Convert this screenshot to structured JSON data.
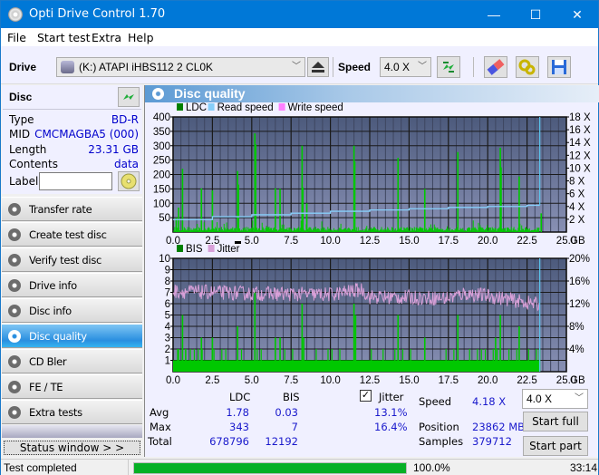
{
  "window": {
    "title": "Opti Drive Control 1.70",
    "minimize": "—",
    "maximize": "☐",
    "close": "✕"
  },
  "menu": [
    "File",
    "Start test",
    "Extra",
    "Help"
  ],
  "toolbar": {
    "drive_label": "Drive",
    "drive_value": "(K:)  ATAPI iHBS112  2 CL0K",
    "speed_label": "Speed",
    "speed_value": "4.0 X"
  },
  "disc": {
    "header": "Disc",
    "rows": [
      {
        "label": "Type",
        "value": "BD-R"
      },
      {
        "label": "MID",
        "value": "CMCMAGBA5 (000)"
      },
      {
        "label": "Length",
        "value": "23.31 GB"
      },
      {
        "label": "Contents",
        "value": "data"
      }
    ],
    "label_field_label": "Label",
    "label_field_value": ""
  },
  "nav": [
    {
      "label": "Transfer rate",
      "active": false
    },
    {
      "label": "Create test disc",
      "active": false
    },
    {
      "label": "Verify test disc",
      "active": false
    },
    {
      "label": "Drive info",
      "active": false
    },
    {
      "label": "Disc info",
      "active": false
    },
    {
      "label": "Disc quality",
      "active": true
    },
    {
      "label": "CD Bler",
      "active": false
    },
    {
      "label": "FE / TE",
      "active": false
    },
    {
      "label": "Extra tests",
      "active": false
    }
  ],
  "status_window_button": "Status window > >",
  "panel_title": "Disc quality",
  "chart_data": [
    {
      "type": "bar",
      "title": "LDC / Read speed",
      "legend": [
        "LDC",
        "Read speed",
        "Write speed"
      ],
      "legend_colors": [
        "#008000",
        "#87cefa",
        "#ff80ff"
      ],
      "legend_placement": "top-left",
      "xlabel": "GB",
      "x_ticks": [
        "0.0",
        "2.5",
        "5.0",
        "7.5",
        "10.0",
        "12.5",
        "15.0",
        "17.5",
        "20.0",
        "22.5",
        "25.0"
      ],
      "xlim": [
        0,
        25
      ],
      "ylim": [
        0,
        400
      ],
      "y_ticks": [
        "50",
        "100",
        "150",
        "200",
        "250",
        "300",
        "350",
        "400"
      ],
      "y2lim": [
        0,
        18
      ],
      "y2_ticks": [
        "2 X",
        "4 X",
        "6 X",
        "8 X",
        "10 X",
        "12 X",
        "14 X",
        "16 X",
        "18 X"
      ],
      "grid": true,
      "ldc_spikes": [
        [
          0.2,
          50
        ],
        [
          0.35,
          85
        ],
        [
          0.6,
          220
        ],
        [
          1.8,
          152
        ],
        [
          2.5,
          145
        ],
        [
          4.1,
          212
        ],
        [
          4.15,
          165
        ],
        [
          5.2,
          343
        ],
        [
          5.25,
          305
        ],
        [
          6.5,
          152
        ],
        [
          6.8,
          150
        ],
        [
          8.2,
          300
        ],
        [
          8.25,
          155
        ],
        [
          8.5,
          100
        ],
        [
          11.5,
          300
        ],
        [
          11.55,
          245
        ],
        [
          14.3,
          258
        ],
        [
          16.0,
          150
        ],
        [
          18.1,
          278
        ],
        [
          20.8,
          293
        ],
        [
          20.85,
          225
        ],
        [
          22.0,
          193
        ],
        [
          23.4,
          65
        ]
      ],
      "read_speed": [
        [
          0,
          1.95
        ],
        [
          2.5,
          2.4
        ],
        [
          5,
          2.7
        ],
        [
          7.5,
          2.95
        ],
        [
          10,
          3.25
        ],
        [
          12.5,
          3.45
        ],
        [
          15,
          3.65
        ],
        [
          17.5,
          3.85
        ],
        [
          20,
          4.0
        ],
        [
          22.5,
          4.18
        ],
        [
          23.31,
          4.18
        ]
      ],
      "end_marker_gb": 23.31
    },
    {
      "type": "bar",
      "title": "BIS / Jitter",
      "legend": [
        "BIS",
        "Jitter"
      ],
      "legend_colors": [
        "#008000",
        "#d8a0d8"
      ],
      "legend_placement": "top-left",
      "xlabel": "GB",
      "x_ticks": [
        "0.0",
        "2.5",
        "5.0",
        "7.5",
        "10.0",
        "12.5",
        "15.0",
        "17.5",
        "20.0",
        "22.5",
        "25.0"
      ],
      "xlim": [
        0,
        25
      ],
      "ylim": [
        0,
        10
      ],
      "y_ticks": [
        "1",
        "2",
        "3",
        "4",
        "5",
        "6",
        "7",
        "8",
        "9",
        "10"
      ],
      "y2lim": [
        0,
        20
      ],
      "y2_ticks": [
        "4%",
        "8%",
        "12%",
        "16%",
        "20%"
      ],
      "grid": true,
      "bis_spikes": [
        [
          0.3,
          2
        ],
        [
          0.6,
          5
        ],
        [
          0.8,
          2
        ],
        [
          1.8,
          3
        ],
        [
          2.5,
          3
        ],
        [
          4.1,
          4
        ],
        [
          5.2,
          7
        ],
        [
          6.5,
          3
        ],
        [
          6.8,
          3
        ],
        [
          8.2,
          6
        ],
        [
          8.3,
          3
        ],
        [
          11.5,
          6
        ],
        [
          11.6,
          5
        ],
        [
          14.3,
          5
        ],
        [
          16.0,
          3
        ],
        [
          18.1,
          5
        ],
        [
          20.5,
          3
        ],
        [
          20.8,
          5
        ],
        [
          22.0,
          4
        ],
        [
          23.3,
          2
        ]
      ],
      "jitter_level_pct": [
        [
          0,
          14.2
        ],
        [
          5,
          13.8
        ],
        [
          10,
          13.6
        ],
        [
          12,
          14.5
        ],
        [
          12.5,
          13.2
        ],
        [
          17.5,
          13.0
        ],
        [
          18.5,
          13.8
        ],
        [
          20,
          13.4
        ],
        [
          23.3,
          11.8
        ]
      ],
      "end_marker_gb": 23.31
    }
  ],
  "stats": {
    "col_ldc": "LDC",
    "col_bis": "BIS",
    "jitter_label": "Jitter",
    "jitter_checked": true,
    "rows": [
      {
        "label": "Avg",
        "ldc": "1.78",
        "bis": "0.03",
        "jitter": "13.1%"
      },
      {
        "label": "Max",
        "ldc": "343",
        "bis": "7",
        "jitter": "16.4%"
      },
      {
        "label": "Total",
        "ldc": "678796",
        "bis": "12192"
      }
    ],
    "speed_label": "Speed",
    "speed_value": "4.18 X",
    "position_label": "Position",
    "position_value": "23862 MB",
    "samples_label": "Samples",
    "samples_value": "379712",
    "speed_select": "4.0 X",
    "start_full": "Start full",
    "start_part": "Start part"
  },
  "status": {
    "text": "Test completed",
    "progress_pct": 100.0,
    "progress_text": "100.0%",
    "time": "33:14"
  }
}
